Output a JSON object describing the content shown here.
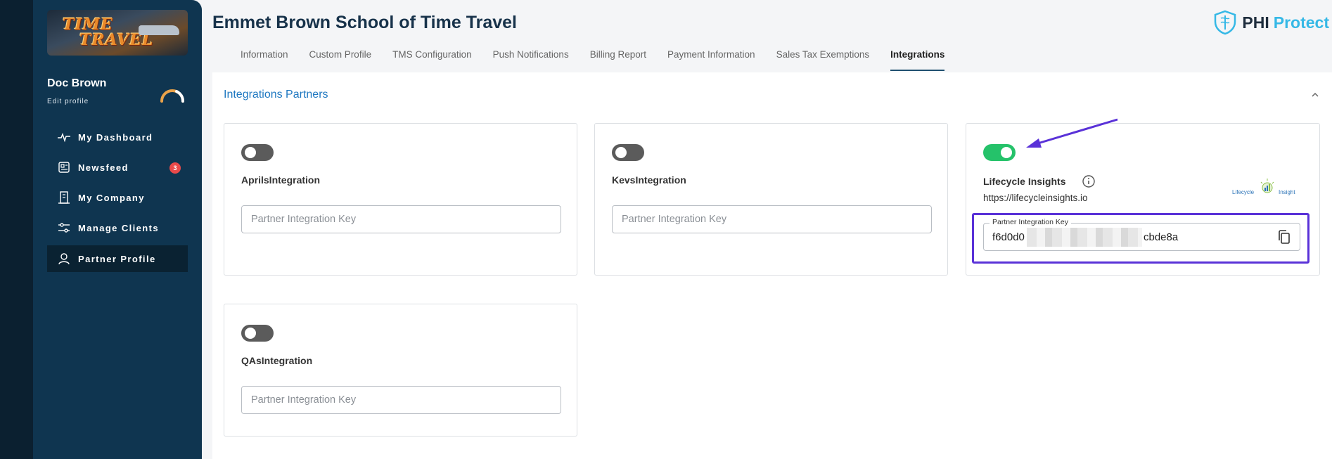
{
  "sidebar": {
    "logo_line1": "TIME",
    "logo_line2": "TRAVEL",
    "user_name": "Doc Brown",
    "edit_profile": "Edit profile",
    "items": [
      {
        "label": "My Dashboard",
        "icon": "activity-icon"
      },
      {
        "label": "Newsfeed",
        "icon": "newspaper-icon",
        "badge": "3"
      },
      {
        "label": "My Company",
        "icon": "building-icon"
      },
      {
        "label": "Manage Clients",
        "icon": "sliders-icon"
      },
      {
        "label": "Partner Profile",
        "icon": "user-icon",
        "active": true
      }
    ]
  },
  "header": {
    "title": "Emmet Brown School of Time Travel",
    "brand_phi": "PHI",
    "brand_protect": "Protect"
  },
  "tabs": [
    {
      "label": "Information"
    },
    {
      "label": "Custom Profile"
    },
    {
      "label": "TMS Configuration"
    },
    {
      "label": "Push Notifications"
    },
    {
      "label": "Billing Report"
    },
    {
      "label": "Payment Information"
    },
    {
      "label": "Sales Tax Exemptions"
    },
    {
      "label": "Integrations",
      "active": true
    }
  ],
  "panel": {
    "title": "Integrations Partners",
    "cards": [
      {
        "name": "AprilsIntegration",
        "enabled": false,
        "key_placeholder": "Partner Integration Key"
      },
      {
        "name": "KevsIntegration",
        "enabled": false,
        "key_placeholder": "Partner Integration Key"
      },
      {
        "name": "QAsIntegration",
        "enabled": false,
        "key_placeholder": "Partner Integration Key"
      }
    ],
    "lifecycle": {
      "name": "Lifecycle Insights",
      "url": "https://lifecycleinsights.io",
      "logo_text_left": "Lifecycle",
      "logo_text_right": "Insights",
      "enabled": true,
      "key_label": "Partner Integration Key",
      "key_start": "f6d0d0",
      "key_end": "cbde8a"
    }
  },
  "colors": {
    "sidebar_bg": "#0f3550",
    "toggle_on": "#25c26a",
    "toggle_off": "#5b5b5b",
    "highlight": "#5a32d8",
    "link_blue": "#1f78c1",
    "badge_red": "#e94a4a",
    "brand_cyan": "#35b8e6"
  }
}
